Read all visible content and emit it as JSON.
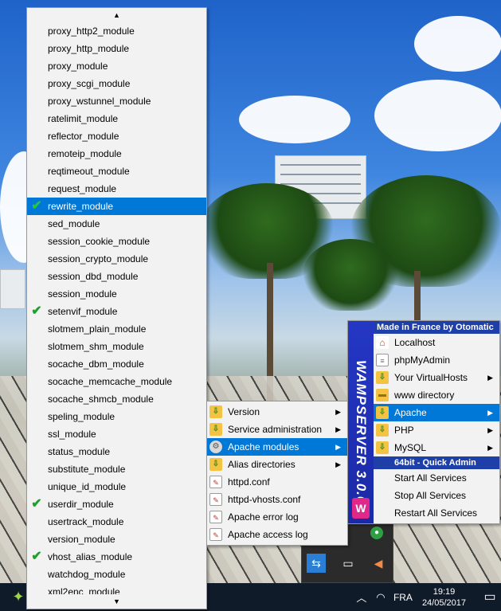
{
  "modules_menu": {
    "scroll_up": "▲",
    "scroll_down": "▼",
    "items": [
      {
        "label": "proxy_http2_module",
        "checked": false
      },
      {
        "label": "proxy_http_module",
        "checked": false
      },
      {
        "label": "proxy_module",
        "checked": false
      },
      {
        "label": "proxy_scgi_module",
        "checked": false
      },
      {
        "label": "proxy_wstunnel_module",
        "checked": false
      },
      {
        "label": "ratelimit_module",
        "checked": false
      },
      {
        "label": "reflector_module",
        "checked": false
      },
      {
        "label": "remoteip_module",
        "checked": false
      },
      {
        "label": "reqtimeout_module",
        "checked": false
      },
      {
        "label": "request_module",
        "checked": false
      },
      {
        "label": "rewrite_module",
        "checked": true,
        "highlighted": true
      },
      {
        "label": "sed_module",
        "checked": false
      },
      {
        "label": "session_cookie_module",
        "checked": false
      },
      {
        "label": "session_crypto_module",
        "checked": false
      },
      {
        "label": "session_dbd_module",
        "checked": false
      },
      {
        "label": "session_module",
        "checked": false
      },
      {
        "label": "setenvif_module",
        "checked": true
      },
      {
        "label": "slotmem_plain_module",
        "checked": false
      },
      {
        "label": "slotmem_shm_module",
        "checked": false
      },
      {
        "label": "socache_dbm_module",
        "checked": false
      },
      {
        "label": "socache_memcache_module",
        "checked": false
      },
      {
        "label": "socache_shmcb_module",
        "checked": false
      },
      {
        "label": "speling_module",
        "checked": false
      },
      {
        "label": "ssl_module",
        "checked": false
      },
      {
        "label": "status_module",
        "checked": false
      },
      {
        "label": "substitute_module",
        "checked": false
      },
      {
        "label": "unique_id_module",
        "checked": false
      },
      {
        "label": "userdir_module",
        "checked": true
      },
      {
        "label": "usertrack_module",
        "checked": false
      },
      {
        "label": "version_module",
        "checked": false
      },
      {
        "label": "vhost_alias_module",
        "checked": true
      },
      {
        "label": "watchdog_module",
        "checked": false
      },
      {
        "label": "xml2enc_module",
        "checked": false
      }
    ]
  },
  "apache_submenu": {
    "items": [
      {
        "label": "Version",
        "icon": "folder-arrow-icon",
        "has_submenu": true
      },
      {
        "label": "Service administration",
        "icon": "folder-arrow-icon",
        "has_submenu": true
      },
      {
        "label": "Apache modules",
        "icon": "gear-icon",
        "has_submenu": true,
        "highlighted": true
      },
      {
        "label": "Alias directories",
        "icon": "folder-arrow-icon",
        "has_submenu": true
      },
      {
        "label": "httpd.conf",
        "icon": "document-edit-icon",
        "has_submenu": false
      },
      {
        "label": "httpd-vhosts.conf",
        "icon": "document-edit-icon",
        "has_submenu": false
      },
      {
        "label": "Apache error log",
        "icon": "document-edit-icon",
        "has_submenu": false
      },
      {
        "label": "Apache access log",
        "icon": "document-edit-icon",
        "has_submenu": false
      }
    ]
  },
  "wamp_menu": {
    "brand_vertical": "WAMPSERVER 3.0.6",
    "logo_letter": "W",
    "header": "Made in France by Otomatic",
    "items": [
      {
        "label": "Localhost",
        "icon": "house-icon",
        "has_submenu": false
      },
      {
        "label": "phpMyAdmin",
        "icon": "database-icon",
        "has_submenu": false
      },
      {
        "label": "Your VirtualHosts",
        "icon": "folder-arrow-icon",
        "has_submenu": true
      },
      {
        "label": "www directory",
        "icon": "folder-icon",
        "has_submenu": false
      },
      {
        "label": "Apache",
        "icon": "folder-arrow-icon",
        "has_submenu": true,
        "highlighted": true
      },
      {
        "label": "PHP",
        "icon": "folder-arrow-icon",
        "has_submenu": true
      },
      {
        "label": "MySQL",
        "icon": "folder-arrow-icon",
        "has_submenu": true
      }
    ],
    "quick_admin_header": "64bit - Quick Admin",
    "quick_items": [
      {
        "label": "Start All Services"
      },
      {
        "label": "Stop All Services"
      },
      {
        "label": "Restart All Services"
      }
    ]
  },
  "taskbar": {
    "language": "FRA",
    "time": "19:19",
    "date": "24/05/2017",
    "colors": {
      "background": "#101b2a",
      "highlight": "#0078d7",
      "wamp_blue": "#2437c4"
    }
  }
}
